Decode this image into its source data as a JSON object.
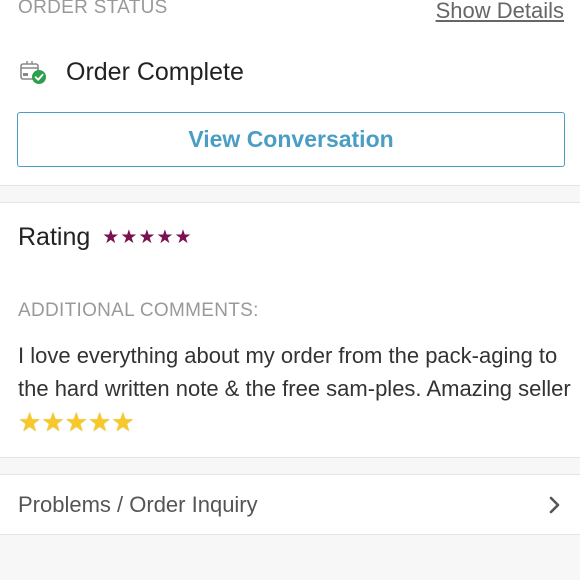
{
  "order_status": {
    "heading": "ORDER STATUS",
    "show_details_label": "Show Details",
    "status_text": "Order Complete",
    "status_icon": "package-check-icon",
    "view_conversation_label": "View Conversation"
  },
  "rating": {
    "label": "Rating",
    "stars": 5,
    "star_color": "#7a1150"
  },
  "comments": {
    "heading": "ADDITIONAL COMMENTS:",
    "text": "I love everything about my order from the pack-aging to the hard written note & the free sam-ples. Amazing seller",
    "emoji_stars": 5
  },
  "inquiry": {
    "label": "Problems / Order Inquiry",
    "icon": "chevron-right-icon"
  },
  "colors": {
    "accent_blue": "#4a9ec4",
    "heading_gray": "#999999",
    "check_green": "#2e9e4f"
  }
}
